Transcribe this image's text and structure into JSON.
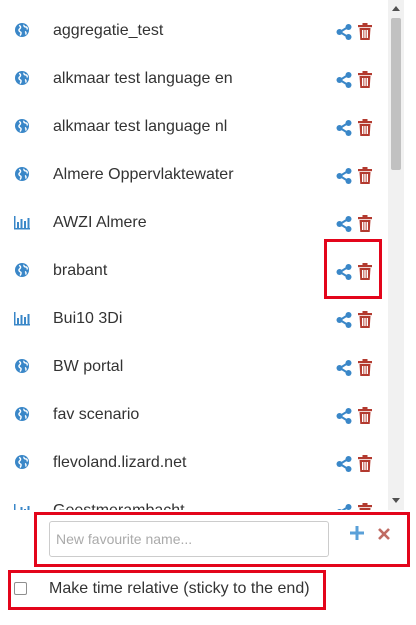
{
  "colors": {
    "accent": "#3a87c8",
    "danger": "#b33a2f",
    "highlight": "#e3051b",
    "text": "#333333"
  },
  "favourites": [
    {
      "label": "aggregatie_test",
      "type_icon": "globe-icon"
    },
    {
      "label": "alkmaar test language en",
      "type_icon": "globe-icon"
    },
    {
      "label": "alkmaar test language nl",
      "type_icon": "globe-icon"
    },
    {
      "label": "Almere Oppervlaktewater",
      "type_icon": "globe-icon"
    },
    {
      "label": "AWZI Almere",
      "type_icon": "bar-chart-icon"
    },
    {
      "label": "brabant",
      "type_icon": "globe-icon"
    },
    {
      "label": "Bui10 3Di",
      "type_icon": "bar-chart-icon"
    },
    {
      "label": "BW portal",
      "type_icon": "globe-icon"
    },
    {
      "label": "fav scenario",
      "type_icon": "globe-icon"
    },
    {
      "label": "flevoland.lizard.net",
      "type_icon": "globe-icon"
    },
    {
      "label": "Geestmerambacht",
      "type_icon": "bar-chart-icon"
    }
  ],
  "new_favourite": {
    "placeholder": "New favourite name...",
    "value": ""
  },
  "relative_time": {
    "label": "Make time relative (sticky to the end)",
    "checked": false
  }
}
